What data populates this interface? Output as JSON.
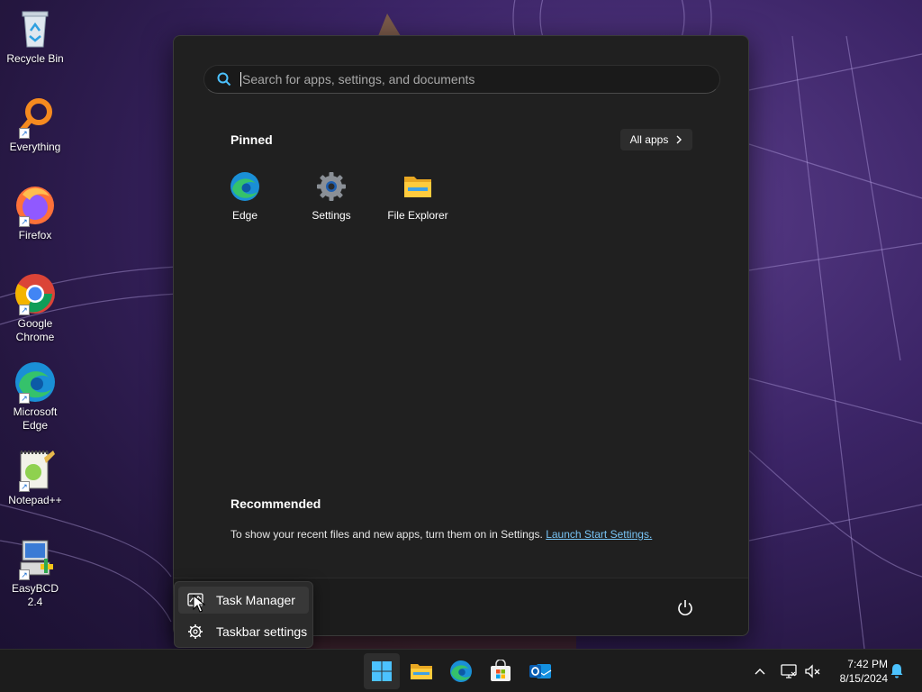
{
  "desktop": {
    "icons": [
      {
        "label": "Recycle Bin",
        "icon": "recycle-bin-icon"
      },
      {
        "label": "Everything",
        "icon": "everything-search-icon"
      },
      {
        "label": "Firefox",
        "icon": "firefox-icon"
      },
      {
        "label": "Google Chrome",
        "icon": "chrome-icon"
      },
      {
        "label": "Microsoft Edge",
        "icon": "edge-icon"
      },
      {
        "label": "Notepad++",
        "icon": "notepad-plus-plus-icon"
      },
      {
        "label": "EasyBCD 2.4",
        "icon": "easybcd-icon"
      }
    ]
  },
  "start_menu": {
    "search_placeholder": "Search for apps, settings, and documents",
    "pinned_title": "Pinned",
    "all_apps_label": "All apps",
    "pinned": [
      {
        "label": "Edge",
        "icon": "edge-icon"
      },
      {
        "label": "Settings",
        "icon": "settings-gear-icon"
      },
      {
        "label": "File Explorer",
        "icon": "folder-icon"
      }
    ],
    "recommended_title": "Recommended",
    "recommended_text": "To show your recent files and new apps, turn them on in Settings.",
    "recommended_link": "Launch Start Settings."
  },
  "context_menu": {
    "items": [
      {
        "label": "Task Manager",
        "icon": "task-manager-icon"
      },
      {
        "label": "Taskbar settings",
        "icon": "gear-icon"
      }
    ]
  },
  "taskbar": {
    "apps": [
      "start-icon",
      "file-explorer-icon",
      "edge-icon",
      "microsoft-store-icon",
      "outlook-icon"
    ],
    "clock_time": "7:42 PM",
    "clock_date": "8/15/2024"
  },
  "colors": {
    "accent": "#4cc2ff",
    "link": "#78c4f5",
    "start_bg": "#202020"
  }
}
